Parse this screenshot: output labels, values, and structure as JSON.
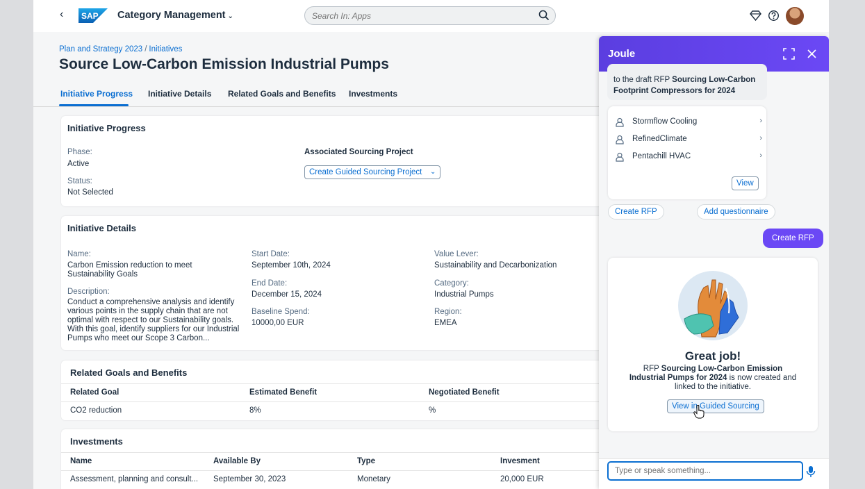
{
  "shell": {
    "back_icon": "‹",
    "app_title": "Category Management",
    "search_placeholder": "Search In: Apps"
  },
  "header": {
    "breadcrumb": [
      "Plan and Strategy 2023",
      "Initiatives"
    ],
    "breadcrumb_sep": "/",
    "title": "Source Low-Carbon Emission Industrial Pumps",
    "tabs": [
      "Initiative Progress",
      "Initiative Details",
      "Related Goals and Benefits",
      "Investments"
    ]
  },
  "progress": {
    "title": "Initiative Progress",
    "phase_label": "Phase:",
    "phase_value": "Active",
    "status_label": "Status:",
    "status_value": "Not Selected",
    "assoc_title": "Associated Sourcing Project",
    "create_btn": "Create Guided Sourcing Project"
  },
  "details": {
    "title": "Initiative Details",
    "name_label": "Name:",
    "name_value": "Carbon Emission reduction to meet Sustainability Goals",
    "desc_label": "Description:",
    "desc_value": "Conduct a comprehensive analysis and identify various points in the supply chain that are not optimal with respect to our Sustainability goals. With this goal, identify suppliers for our Industrial Pumps who meet our Scope 3 Carbon...",
    "start_label": "Start Date:",
    "start_value": "September 10th, 2024",
    "end_label": "End Date:",
    "end_value": "December 15, 2024",
    "baseline_label": "Baseline Spend:",
    "baseline_value": "10000,00 EUR",
    "lever_label": "Value Lever:",
    "lever_value": "Sustainability and Decarbonization",
    "category_label": "Category:",
    "category_value": "Industrial Pumps",
    "region_label": "Region:",
    "region_value": "EMEA"
  },
  "goals": {
    "title": "Related Goals and Benefits",
    "columns": [
      "Related Goal",
      "Estimated Benefit",
      "Negotiated Benefit"
    ],
    "rows": [
      [
        "CO2 reduction",
        "8%",
        "%"
      ]
    ]
  },
  "investments": {
    "title": "Investments",
    "columns": [
      "Name",
      "Available By",
      "Type",
      "Invesment"
    ],
    "rows": [
      [
        "Assessment, planning and consult...",
        "September 30, 2023",
        "Monetary",
        "20,000 EUR"
      ]
    ]
  },
  "joule": {
    "title": "Joule",
    "msg_line1": "to the draft RFP",
    "msg_bold1": "Sourcing Low-Carbon",
    "msg_bold2": "Footprint Compressors for 2024",
    "suppliers": [
      "Stormflow Cooling",
      "RefinedClimate",
      "Pentachill HVAC"
    ],
    "view_btn": "View",
    "action1": "Create RFP",
    "action2": "Add questionnaire",
    "user_msg": "Create RFP",
    "great_job": "Great job!",
    "gj_pre": "RFP",
    "gj_bold": "Sourcing Low-Carbon Emission Industrial Pumps for 2024",
    "gj_post": "is now created and linked to the initiative.",
    "gj_btn": "View in Guided Sourcing",
    "input_placeholder": "Type or speak something..."
  },
  "colors": {
    "accent": "#0a6ed1",
    "joule_header": "#5b3ee0",
    "user_bubble": "#6b48f5"
  }
}
